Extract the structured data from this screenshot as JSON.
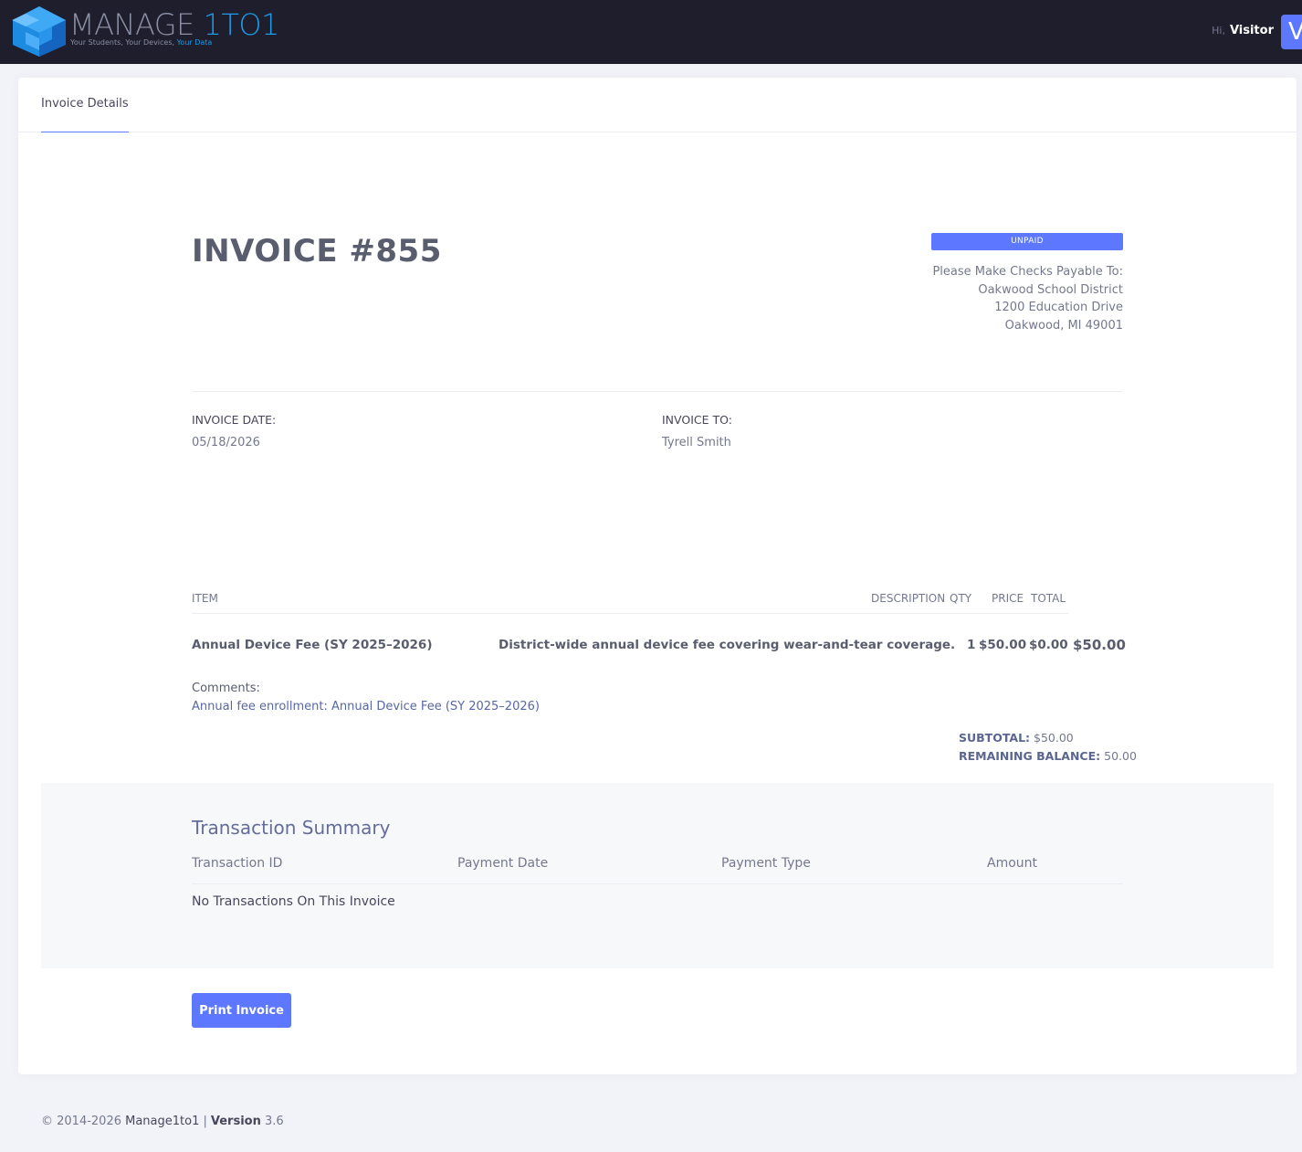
{
  "header": {
    "brand_main": "MANAGE ",
    "brand_accent": "1TO1",
    "tagline_main": "Your Students, Your Devices, ",
    "tagline_accent": "Your Data",
    "greeting": "Hi,",
    "user_name": "Visitor",
    "avatar_letter": "V",
    "colors": {
      "bar": "#1e1e2d",
      "accent": "#1d9be8",
      "avatar": "#5d78ff"
    }
  },
  "tabs": [
    {
      "label": "Invoice Details",
      "active": true
    }
  ],
  "invoice": {
    "title": "INVOICE #855",
    "status": "UNPAID",
    "status_color": "#5d78ff",
    "payable": {
      "heading": "Please Make Checks Payable To:",
      "name": "Oakwood School District",
      "street": "1200 Education Drive",
      "city": "Oakwood, MI 49001"
    },
    "date_label": "INVOICE DATE:",
    "date": "05/18/2026",
    "to_label": "INVOICE TO:",
    "to": "Tyrell Smith",
    "columns": {
      "item": "ITEM",
      "description": "DESCRIPTION",
      "qty": "QTY",
      "price": "PRICE",
      "total": "TOTAL"
    },
    "line_items": [
      {
        "item": "Annual Device Fee (SY 2025–2026)",
        "description": "District-wide annual device fee covering wear-and-tear coverage.",
        "qty": "1",
        "price": "$50.00",
        "discount": "$0.00",
        "total": "$50.00"
      }
    ],
    "comments_label": "Comments:",
    "comments": "Annual fee enrollment: Annual Device Fee (SY 2025–2026)",
    "subtotal_label": "SUBTOTAL:",
    "subtotal": "$50.00",
    "balance_label": "REMAINING BALANCE:",
    "balance": "50.00"
  },
  "transactions": {
    "title": "Transaction Summary",
    "columns": [
      "Transaction ID",
      "Payment Date",
      "Payment Type",
      "Amount"
    ],
    "empty_message": "No Transactions On This Invoice"
  },
  "actions": {
    "print_label": "Print Invoice"
  },
  "footer": {
    "copyright": "© 2014-2026 ",
    "company": "Manage1to1",
    "separator": "  |",
    "version_label": "Version",
    "version": " 3.6"
  }
}
